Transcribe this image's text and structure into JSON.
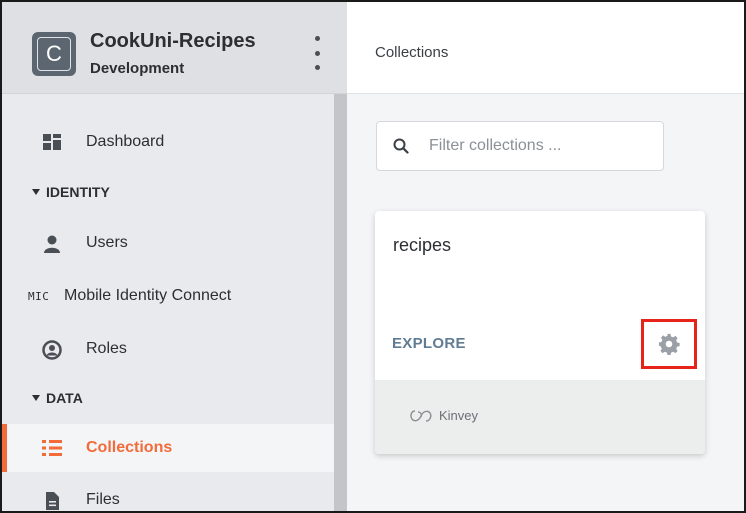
{
  "app": {
    "name": "CookUni-Recipes",
    "environment": "Development",
    "logo_letter": "C"
  },
  "sidebar": {
    "items": [
      {
        "label": "Dashboard",
        "icon": "dashboard-icon"
      },
      {
        "section": "IDENTITY"
      },
      {
        "label": "Users",
        "icon": "user-icon"
      },
      {
        "label": "Mobile Identity Connect",
        "prefix": "MIC"
      },
      {
        "label": "Roles",
        "icon": "roles-icon"
      },
      {
        "section": "DATA"
      },
      {
        "label": "Collections",
        "icon": "list-icon",
        "active": true
      },
      {
        "label": "Files",
        "icon": "file-icon"
      }
    ]
  },
  "header": {
    "breadcrumb": "Collections"
  },
  "search": {
    "placeholder": "Filter collections ..."
  },
  "collections": [
    {
      "name": "recipes",
      "explore_label": "EXPLORE",
      "footer_brand": "Kinvey"
    }
  ],
  "colors": {
    "accent": "#f26b3a",
    "highlight_box": "#e8231b",
    "explore": "#5f7c92"
  }
}
